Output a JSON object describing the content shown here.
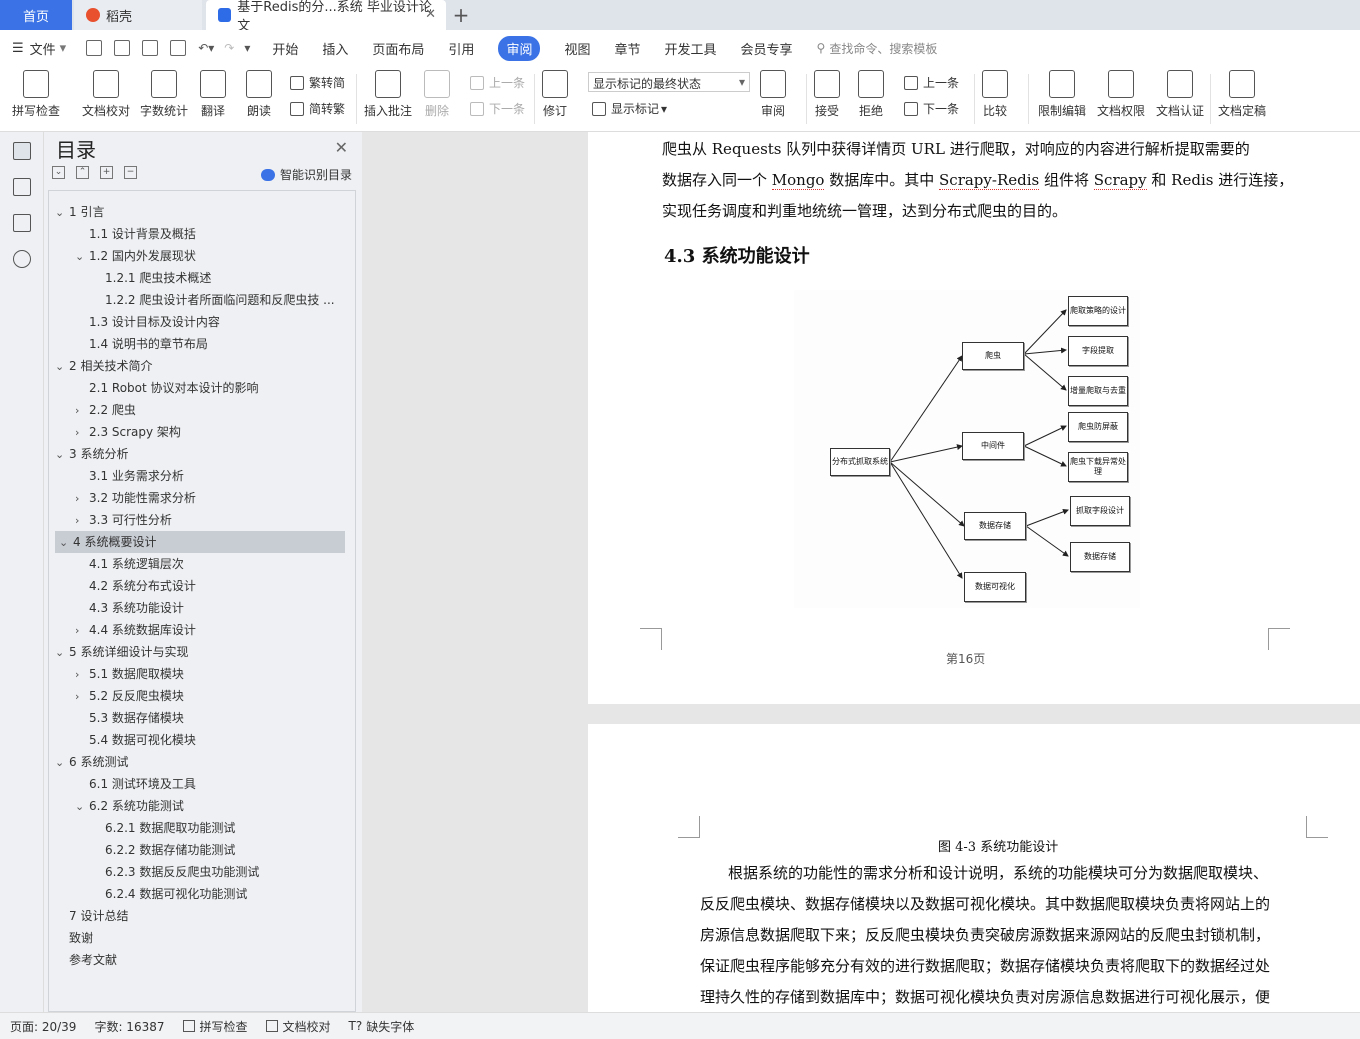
{
  "tabs": {
    "home": "首页",
    "daoke": "稻壳",
    "doc": "基于Redis的分...系统 毕业设计论文"
  },
  "menu": {
    "file": "文件",
    "items": [
      "开始",
      "插入",
      "页面布局",
      "引用",
      "审阅",
      "视图",
      "章节",
      "开发工具",
      "会员专享"
    ],
    "search": "查找命令、搜索模板"
  },
  "ribbon": {
    "spell": "拼写检查",
    "proof": "文档校对",
    "count": "字数统计",
    "translate": "翻译",
    "read": "朗读",
    "trad": "繁转简",
    "simp": "简转繁",
    "insert_comment": "插入批注",
    "delete": "删除",
    "prev": "上一条",
    "next": "下一条",
    "revise": "修订",
    "markup_state": "显示标记的最终状态",
    "show_markup": "显示标记",
    "review": "审阅",
    "accept": "接受",
    "reject": "拒绝",
    "prev2": "上一条",
    "next2": "下一条",
    "compare": "比较",
    "restrict": "限制编辑",
    "rights": "文档权限",
    "auth": "文档认证",
    "finalize": "文档定稿"
  },
  "toc": {
    "title": "目录",
    "smart": "智能识别目录",
    "items": [
      "1  引言",
      "1.1  设计背景及概括",
      "1.2  国内外发展现状",
      "1.2.1  爬虫技术概述",
      "1.2.2  爬虫设计者所面临问题和反爬虫技 ...",
      "1.3  设计目标及设计内容",
      "1.4  说明书的章节布局",
      "2  相关技术简介",
      "2.1 Robot 协议对本设计的影响",
      "2.2  爬虫",
      "2.3 Scrapy 架构",
      "3  系统分析",
      "3.1  业务需求分析",
      "3.2  功能性需求分析",
      "3.3  可行性分析",
      "4  系统概要设计",
      "4.1  系统逻辑层次",
      "4.2  系统分布式设计",
      "4.3  系统功能设计",
      "4.4  系统数据库设计",
      "5  系统详细设计与实现",
      "5.1  数据爬取模块",
      "5.2  反反爬虫模块",
      "5.3  数据存储模块",
      "5.4  数据可视化模块",
      "6  系统测试",
      "6.1  测试环境及工具",
      "6.2  系统功能测试",
      "6.2.1  数据爬取功能测试",
      "6.2.2  数据存储功能测试",
      "6.2.3  数据反反爬虫功能测试",
      "6.2.4  数据可视化功能测试",
      "7  设计总结",
      "致谢",
      "参考文献"
    ]
  },
  "page1": {
    "line1": "爬虫从 Requests 队列中获得详情页 URL 进行爬取，对响应的内容进行解析提取需要的",
    "line2a": "数据存入同一个 ",
    "line2b": "Mongo",
    "line2c": " 数据库中。其中 ",
    "line2d": "Scrapy-Redis",
    "line2e": " 组件将 ",
    "line2f": "Scrapy",
    "line2g": " 和 Redis 进行连接，",
    "line3": "实现任务调度和判重地统统一管理，达到分布式爬虫的目的。",
    "heading": "4.3  系统功能设计",
    "page_number": "第16页"
  },
  "diagram": {
    "root": "分布式抓取系统",
    "crawler": "爬虫",
    "middleware": "中间件",
    "storage": "数据存储",
    "visual": "数据可视化",
    "c1": "爬取策略的设计",
    "c2": "字段提取",
    "c3": "增量爬取与去重",
    "m1": "爬虫防屏蔽",
    "m2": "爬虫下载异常处理",
    "s1": "抓取字段设计",
    "s2": "数据存储"
  },
  "page2": {
    "caption": "图 4-3  系统功能设计",
    "p1": "根据系统的功能性的需求分析和设计说明，系统的功能模块可分为数据爬取模块、",
    "p2": "反反爬虫模块、数据存储模块以及数据可视化模块。其中数据爬取模块负责将网站上的",
    "p3": "房源信息数据爬取下来；反反爬虫模块负责突破房源数据来源网站的反爬虫封锁机制，",
    "p4": "保证爬虫程序能够充分有效的进行数据爬取；数据存储模块负责将爬取下的数据经过处",
    "p5": "理持久性的存储到数据库中；数据可视化模块负责对房源信息数据进行可视化展示，便"
  },
  "status": {
    "page": "页面: 20/39",
    "words": "字数: 16387",
    "spell": "拼写检查",
    "proof": "文档校对",
    "missing_font": "缺失字体"
  }
}
